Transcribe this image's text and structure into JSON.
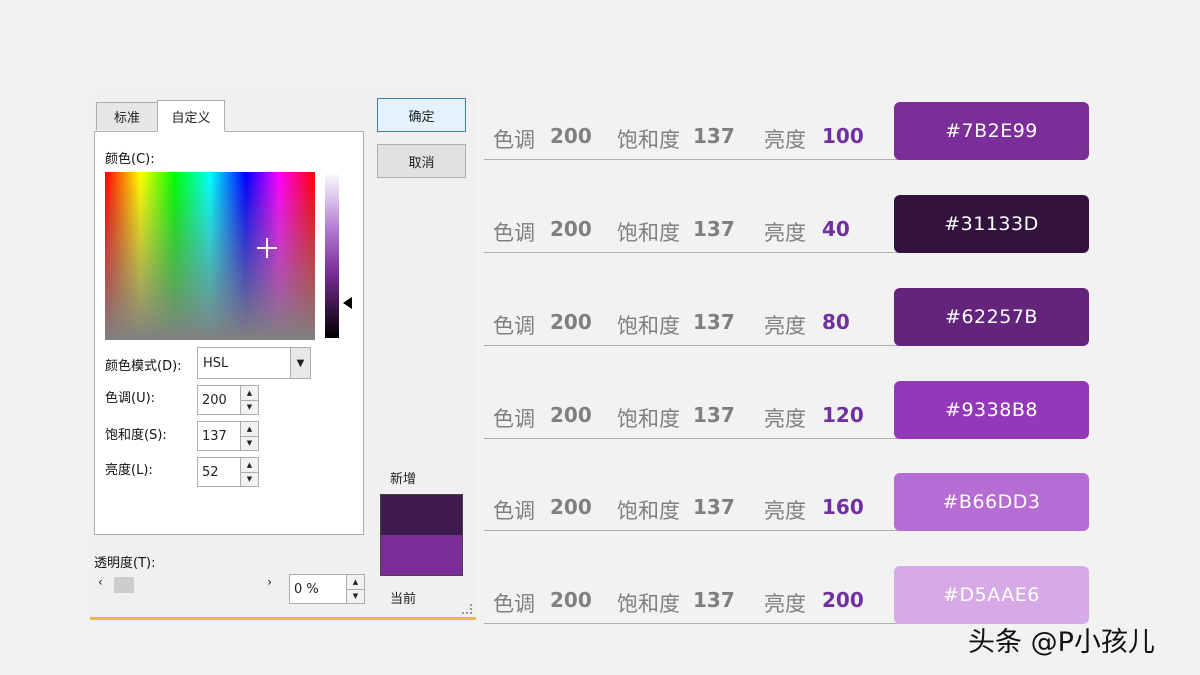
{
  "dialog": {
    "tabs": [
      "标准",
      "自定义"
    ],
    "color_label": "颜色(C):",
    "color_model_label": "颜色模式(D):",
    "color_model_value": "HSL",
    "hue_label": "色调(U):",
    "hue_value": "200",
    "sat_label": "饱和度(S):",
    "sat_value": "137",
    "lum_label": "亮度(L):",
    "lum_value": "52",
    "transparency_label": "透明度(T):",
    "transparency_value": "0 %",
    "ok": "确定",
    "cancel": "取消",
    "new_label": "新增",
    "current_label": "当前",
    "new_color": "#3E1A4F",
    "current_color": "#7B2E99"
  },
  "rows": [
    {
      "hue_label": "色调",
      "hue": "200",
      "sat_label": "饱和度",
      "sat": "137",
      "lum_label": "亮度",
      "lum": "100",
      "hex": "#7B2E99"
    },
    {
      "hue_label": "色调",
      "hue": "200",
      "sat_label": "饱和度",
      "sat": "137",
      "lum_label": "亮度",
      "lum": "40",
      "hex": "#31133D"
    },
    {
      "hue_label": "色调",
      "hue": "200",
      "sat_label": "饱和度",
      "sat": "137",
      "lum_label": "亮度",
      "lum": "80",
      "hex": "#62257B"
    },
    {
      "hue_label": "色调",
      "hue": "200",
      "sat_label": "饱和度",
      "sat": "137",
      "lum_label": "亮度",
      "lum": "120",
      "hex": "#9338B8"
    },
    {
      "hue_label": "色调",
      "hue": "200",
      "sat_label": "饱和度",
      "sat": "137",
      "lum_label": "亮度",
      "lum": "160",
      "hex": "#B66DD3"
    },
    {
      "hue_label": "色调",
      "hue": "200",
      "sat_label": "饱和度",
      "sat": "137",
      "lum_label": "亮度",
      "lum": "200",
      "hex": "#D5AAE6"
    }
  ],
  "colors": {
    "accent_purple": "#7030A0",
    "label_gray": "#7F7F7F"
  },
  "watermark": "头条 @P小孩儿"
}
